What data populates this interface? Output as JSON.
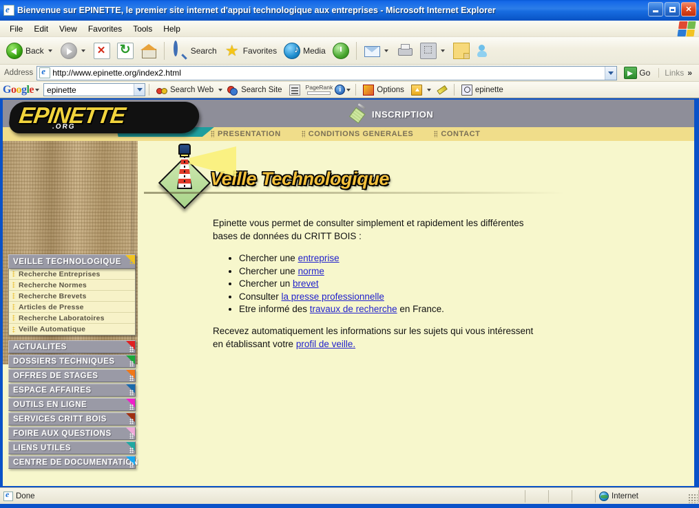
{
  "window": {
    "title": "Bienvenue sur EPINETTE, le premier site internet d'appui technologique aux entreprises - Microsoft Internet Explorer",
    "icon": "ie-page-icon",
    "minimize_label": "Minimize",
    "maximize_label": "Maximize",
    "close_label": "Close"
  },
  "menubar": {
    "items": [
      "File",
      "Edit",
      "View",
      "Favorites",
      "Tools",
      "Help"
    ]
  },
  "toolbar": {
    "back_label": "Back",
    "forward_label": "",
    "stop_label": "",
    "refresh_label": "",
    "home_label": "",
    "search_label": "Search",
    "favorites_label": "Favorites",
    "media_label": "Media",
    "history_label": "",
    "mail_label": "",
    "print_label": "",
    "edit_label": "",
    "discuss_label": "",
    "messenger_label": ""
  },
  "address": {
    "label": "Address",
    "value": "http://www.epinette.org/index2.html",
    "placeholder": "http://",
    "go_label": "Go",
    "links_label": "Links",
    "links_chevron": "»"
  },
  "google_toolbar": {
    "logo": [
      "G",
      "o",
      "o",
      "g",
      "l",
      "e"
    ],
    "search_value": "epinette",
    "search_placeholder": "",
    "search_web_label": "Search Web",
    "search_site_label": "Search Site",
    "news_label": "",
    "pagerank_label": "PageRank",
    "options_label": "Options",
    "autofill_label": "",
    "highlight_label": "",
    "found_term_label": "epinette"
  },
  "site": {
    "logo_text": "EPINETTE",
    "logo_suffix": ".ORG",
    "inscription_label": "INSCRIPTION",
    "nav": [
      {
        "label": "PRESENTATION"
      },
      {
        "label": "CONDITIONS GENERALES"
      },
      {
        "label": "CONTACT"
      }
    ]
  },
  "sidebar": {
    "group": {
      "title": "VEILLE TECHNOLOGIQUE",
      "items": [
        {
          "label": "Recherche Entreprises"
        },
        {
          "label": "Recherche Normes"
        },
        {
          "label": "Recherche Brevets"
        },
        {
          "label": "Articles de Presse"
        },
        {
          "label": "Recherche Laboratoires"
        },
        {
          "label": "Veille Automatique"
        }
      ]
    },
    "items": [
      {
        "label": "ACTUALITES",
        "color": "#e02020"
      },
      {
        "label": "DOSSIERS TECHNIQUES",
        "color": "#1aa83a"
      },
      {
        "label": "OFFRES DE STAGES",
        "color": "#f07818"
      },
      {
        "label": "ESPACE AFFAIRES",
        "color": "#1a6aaa"
      },
      {
        "label": "OUTILS EN LIGNE",
        "color": "#f020c8"
      },
      {
        "label": "SERVICES CRITT BOIS",
        "color": "#a03010"
      },
      {
        "label": "FOIRE AUX QUESTIONS",
        "color": "#f0a8d8"
      },
      {
        "label": "LIENS UTILES",
        "color": "#20a8a0"
      },
      {
        "label": "CENTRE DE DOCUMENTATION",
        "color": "#18a8f0"
      }
    ]
  },
  "content": {
    "page_title": "Veille Technologique",
    "intro": "Epinette vous permet de consulter simplement et rapidement les différentes bases de données du CRITT BOIS :",
    "bullets": [
      {
        "before": "Chercher une ",
        "link": "entreprise",
        "after": ""
      },
      {
        "before": "Chercher une ",
        "link": "norme",
        "after": ""
      },
      {
        "before": "Chercher un ",
        "link": "brevet",
        "after": ""
      },
      {
        "before": "Consulter ",
        "link": "la presse professionnelle",
        "after": ""
      },
      {
        "before": "Etre informé des ",
        "link": "travaux de recherche",
        "after": " en France."
      }
    ],
    "outro_before": "Recevez automatiquement les informations sur les sujets qui vous intéressent en établissant votre ",
    "outro_link": "profil de veille.",
    "outro_after": ""
  },
  "statusbar": {
    "status": "Done",
    "zone": "Internet"
  },
  "colors": {
    "page_background": "#f7f7cc",
    "header_grey": "#8e8e99",
    "nav_yellow": "#f0dd8a",
    "logo_yellow": "#f2d43c",
    "title_yellow": "#f2c03c",
    "link_blue": "#2222cc",
    "sidebar_grey": "#9a9aa6",
    "sublist_cream": "#f7f2c8",
    "titlebar_blue": "#0a52c8"
  }
}
